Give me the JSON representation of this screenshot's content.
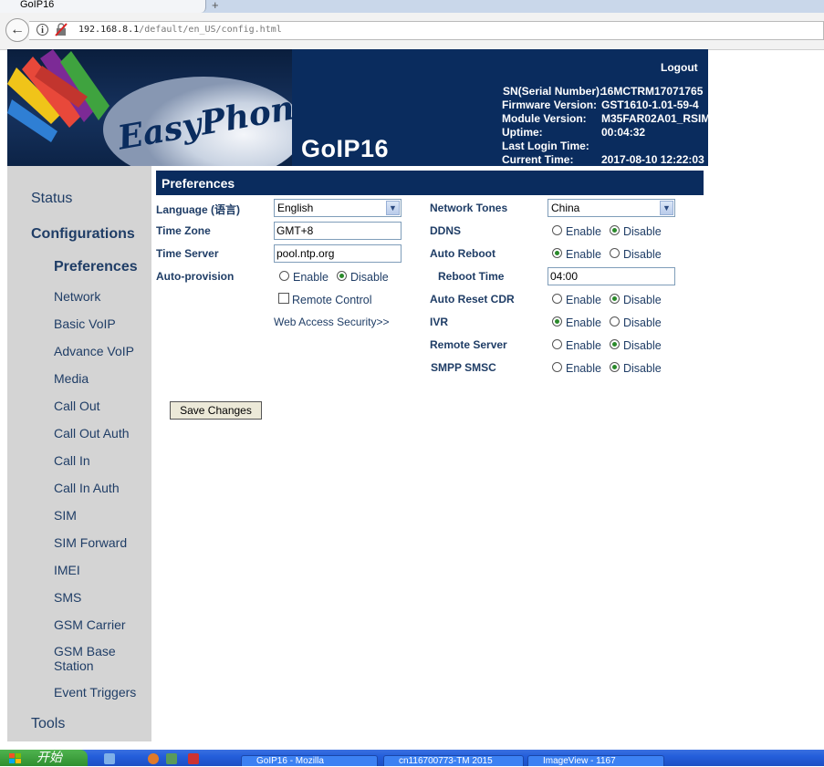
{
  "browser": {
    "tab_title": "GoIP16",
    "url_host": "192.168.8.1",
    "url_path": "/default/en_US/config.html"
  },
  "header": {
    "logo_text": "EasyPhone",
    "product": "GoIP16",
    "logout": "Logout",
    "info": [
      {
        "label": "SN(Serial Number):",
        "value": "16MCTRM17071765"
      },
      {
        "label": "Firmware Version:",
        "value": "GST1610-1.01-59-4"
      },
      {
        "label": "Module Version:",
        "value": "M35FAR02A01_RSIM"
      },
      {
        "label": "Uptime:",
        "value": "00:04:32"
      },
      {
        "label": "Last Login Time:",
        "value": ""
      },
      {
        "label": "Current Time:",
        "value": "2017-08-10 12:22:03"
      }
    ]
  },
  "sidebar": {
    "status": "Status",
    "configurations": "Configurations",
    "items": [
      "Preferences",
      "Network",
      "Basic VoIP",
      "Advance VoIP",
      "Media",
      "Call Out",
      "Call Out Auth",
      "Call In",
      "Call In Auth",
      "SIM",
      "SIM Forward",
      "IMEI",
      "SMS",
      "GSM Carrier",
      "GSM Base Station",
      "Event Triggers"
    ],
    "tools": "Tools"
  },
  "section_title": "Preferences",
  "left_form": {
    "language": {
      "label": "Language (语言)",
      "value": "English"
    },
    "time_zone": {
      "label": "Time Zone",
      "value": "GMT+8"
    },
    "time_server": {
      "label": "Time Server",
      "value": "pool.ntp.org"
    },
    "auto_provision": {
      "label": "Auto-provision",
      "enable": "Enable",
      "disable": "Disable",
      "selected": "disable"
    },
    "remote_control": {
      "label": "Remote Control",
      "checked": false
    },
    "web_access_link": "Web Access Security>>"
  },
  "right_form": {
    "network_tones": {
      "label": "Network Tones",
      "value": "China"
    },
    "ddns": {
      "label": "DDNS",
      "selected": "disable"
    },
    "auto_reboot": {
      "label": "Auto Reboot",
      "selected": "enable"
    },
    "reboot_time": {
      "label": "Reboot Time",
      "value": "04:00"
    },
    "auto_reset_cdr": {
      "label": "Auto Reset CDR",
      "selected": "disable"
    },
    "ivr": {
      "label": "IVR",
      "selected": "enable"
    },
    "remote_server": {
      "label": "Remote Server",
      "selected": "disable"
    },
    "smpp_smsc": {
      "label": "SMPP SMSC",
      "selected": "disable"
    },
    "enable_label": "Enable",
    "disable_label": "Disable"
  },
  "save_button": "Save Changes",
  "taskbar": {
    "start": "开始",
    "tasks": [
      "GoIP16 - Mozilla",
      "cn116700773-TM 2015",
      "ImageView - 1167"
    ]
  },
  "colors": {
    "header_bg": "#0a2c5e",
    "sidebar_bg": "#d4d4d4",
    "text_navy": "#1f3d66",
    "radio_on": "#2a8a2a"
  }
}
